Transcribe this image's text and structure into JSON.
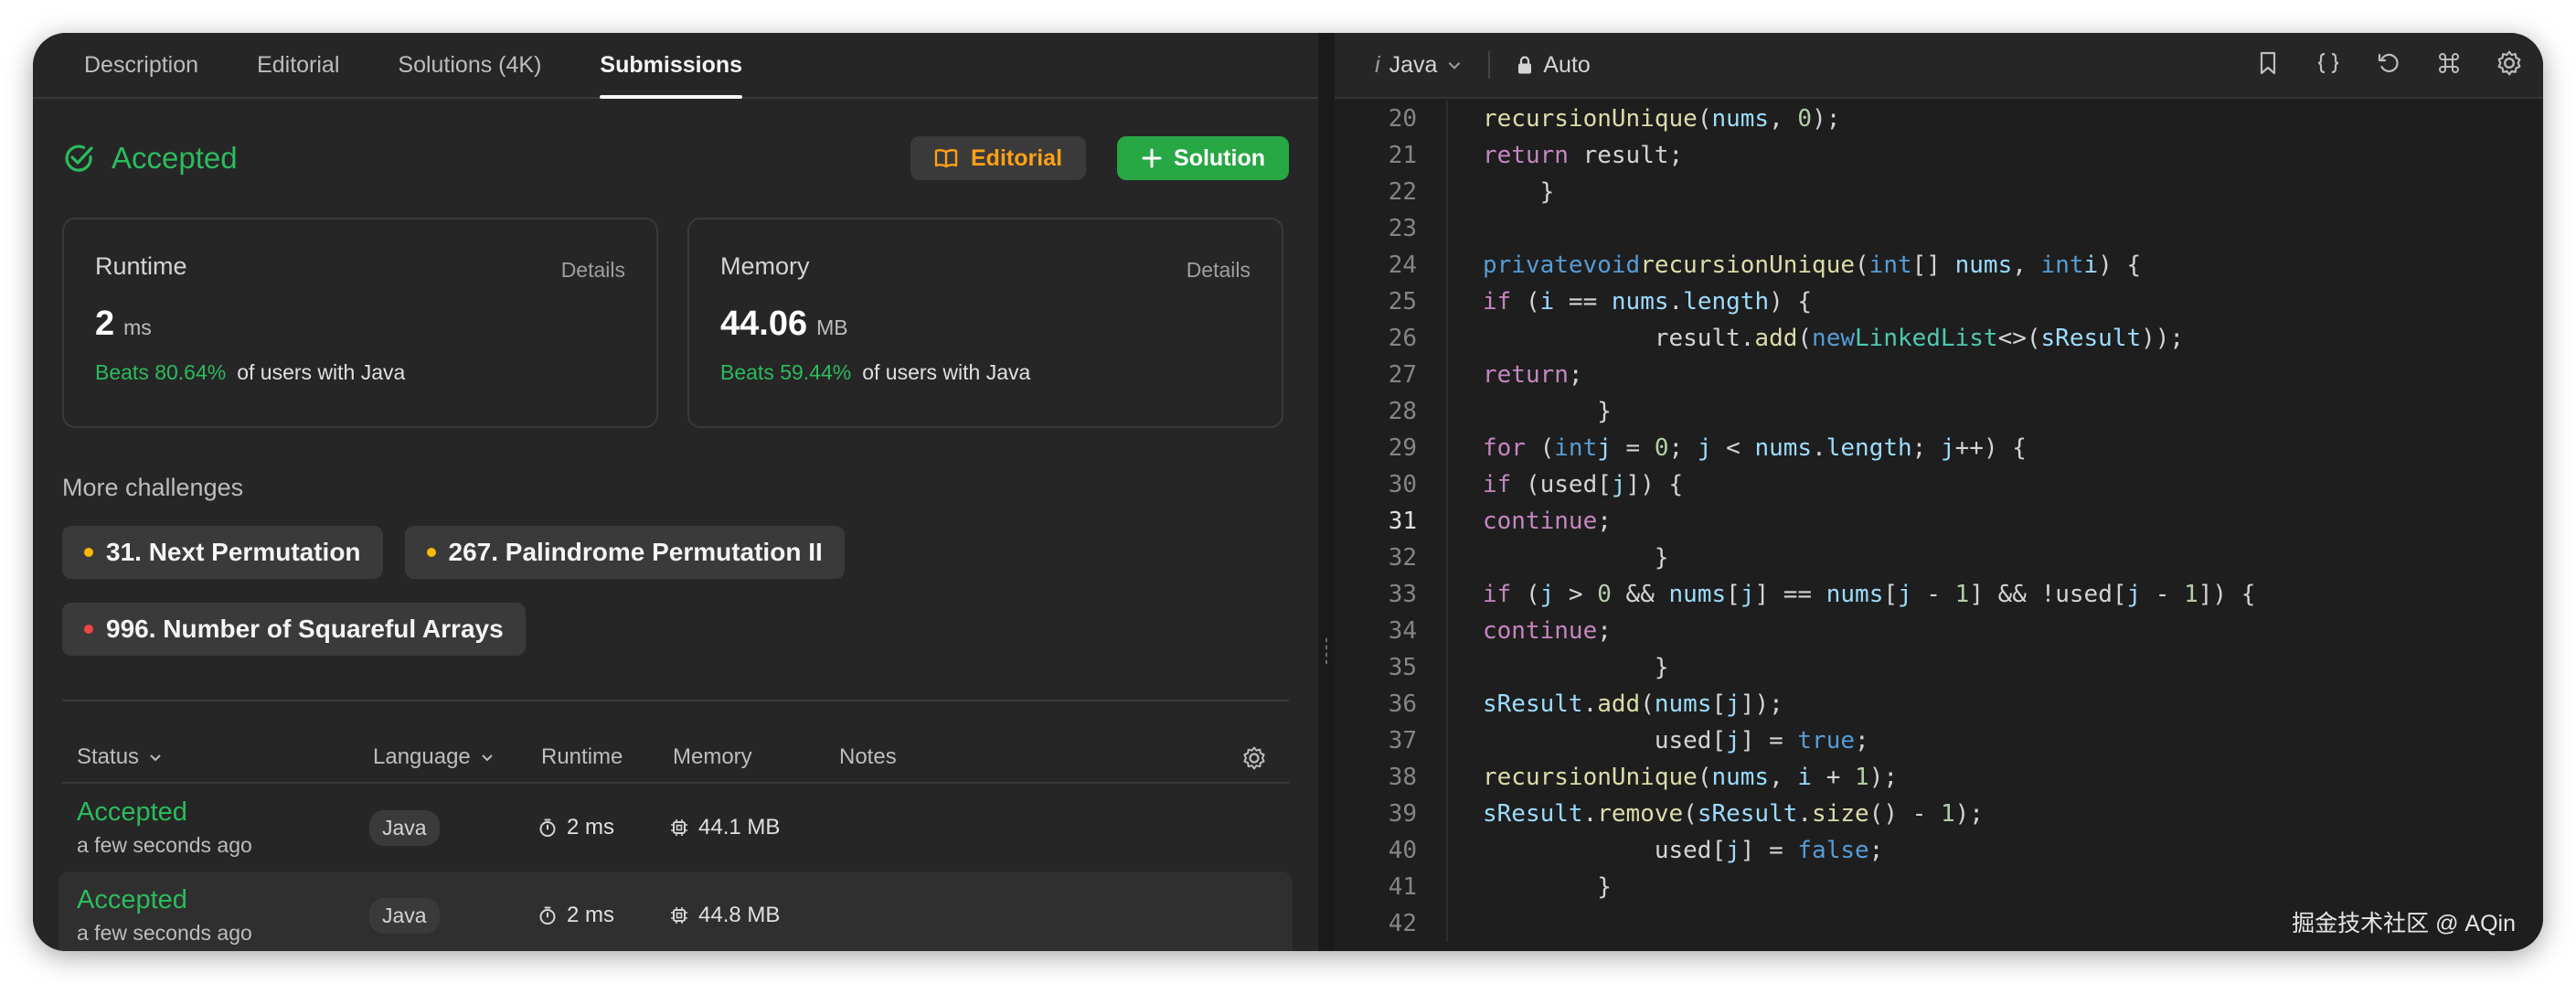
{
  "tabs": [
    "Description",
    "Editorial",
    "Solutions (4K)",
    "Submissions"
  ],
  "status": {
    "title": "Accepted",
    "editorial_label": "Editorial",
    "solution_label": "Solution"
  },
  "runtime": {
    "title": "Runtime",
    "details": "Details",
    "value": "2",
    "unit": "ms",
    "beats": "Beats 80.64%",
    "suffix": "of users with Java"
  },
  "memory": {
    "title": "Memory",
    "details": "Details",
    "value": "44.06",
    "unit": "MB",
    "beats": "Beats 59.44%",
    "suffix": "of users with Java"
  },
  "more": {
    "title": "More challenges",
    "items": [
      {
        "label": "31. Next Permutation",
        "color": "#ffb800"
      },
      {
        "label": "267. Palindrome Permutation II",
        "color": "#ffb800"
      },
      {
        "label": "996. Number of Squareful Arrays",
        "color": "#ef4743"
      }
    ]
  },
  "table": {
    "headers": [
      "Status",
      "Language",
      "Runtime",
      "Memory",
      "Notes"
    ],
    "rows": [
      {
        "status": "Accepted",
        "ago": "a few seconds ago",
        "lang": "Java",
        "runtime": "2 ms",
        "memory": "44.1 MB"
      },
      {
        "status": "Accepted",
        "ago": "a few seconds ago",
        "lang": "Java",
        "runtime": "2 ms",
        "memory": "44.8 MB"
      }
    ]
  },
  "editor": {
    "lang_prefix": "i",
    "lang": "Java",
    "mode": "Auto",
    "current_line": "31",
    "lines": [
      {
        "n": "20",
        "code": "        recursionUnique(nums, 0);"
      },
      {
        "n": "21",
        "code": "        return result;"
      },
      {
        "n": "22",
        "code": "    }"
      },
      {
        "n": "23",
        "code": ""
      },
      {
        "n": "24",
        "code": "    private void recursionUnique(int[] nums, int i) {"
      },
      {
        "n": "25",
        "code": "         if (i == nums.length) {"
      },
      {
        "n": "26",
        "code": "            result.add(new LinkedList<>(sResult));"
      },
      {
        "n": "27",
        "code": "            return;"
      },
      {
        "n": "28",
        "code": "        }"
      },
      {
        "n": "29",
        "code": "        for (int j = 0; j < nums.length; j++) {"
      },
      {
        "n": "30",
        "code": "            if (used[j]) {"
      },
      {
        "n": "31",
        "code": "                continue;"
      },
      {
        "n": "32",
        "code": "            }"
      },
      {
        "n": "33",
        "code": "            if (j > 0 && nums[j] == nums[j - 1] && !used[j - 1]) {"
      },
      {
        "n": "34",
        "code": "                continue;"
      },
      {
        "n": "35",
        "code": "            }"
      },
      {
        "n": "36",
        "code": "            sResult.add(nums[j]);"
      },
      {
        "n": "37",
        "code": "            used[j] = true;"
      },
      {
        "n": "38",
        "code": "            recursionUnique(nums, i + 1);"
      },
      {
        "n": "39",
        "code": "            sResult.remove(sResult.size() - 1);"
      },
      {
        "n": "40",
        "code": "            used[j] = false;"
      },
      {
        "n": "41",
        "code": "        }"
      },
      {
        "n": "42",
        "code": ""
      }
    ]
  },
  "watermark": "掘金技术社区 @ AQin",
  "colors": {
    "accent_green": "#2cbb5d",
    "editorial_orange": "#ffa116",
    "medium": "#ffb800",
    "hard": "#ef4743"
  }
}
